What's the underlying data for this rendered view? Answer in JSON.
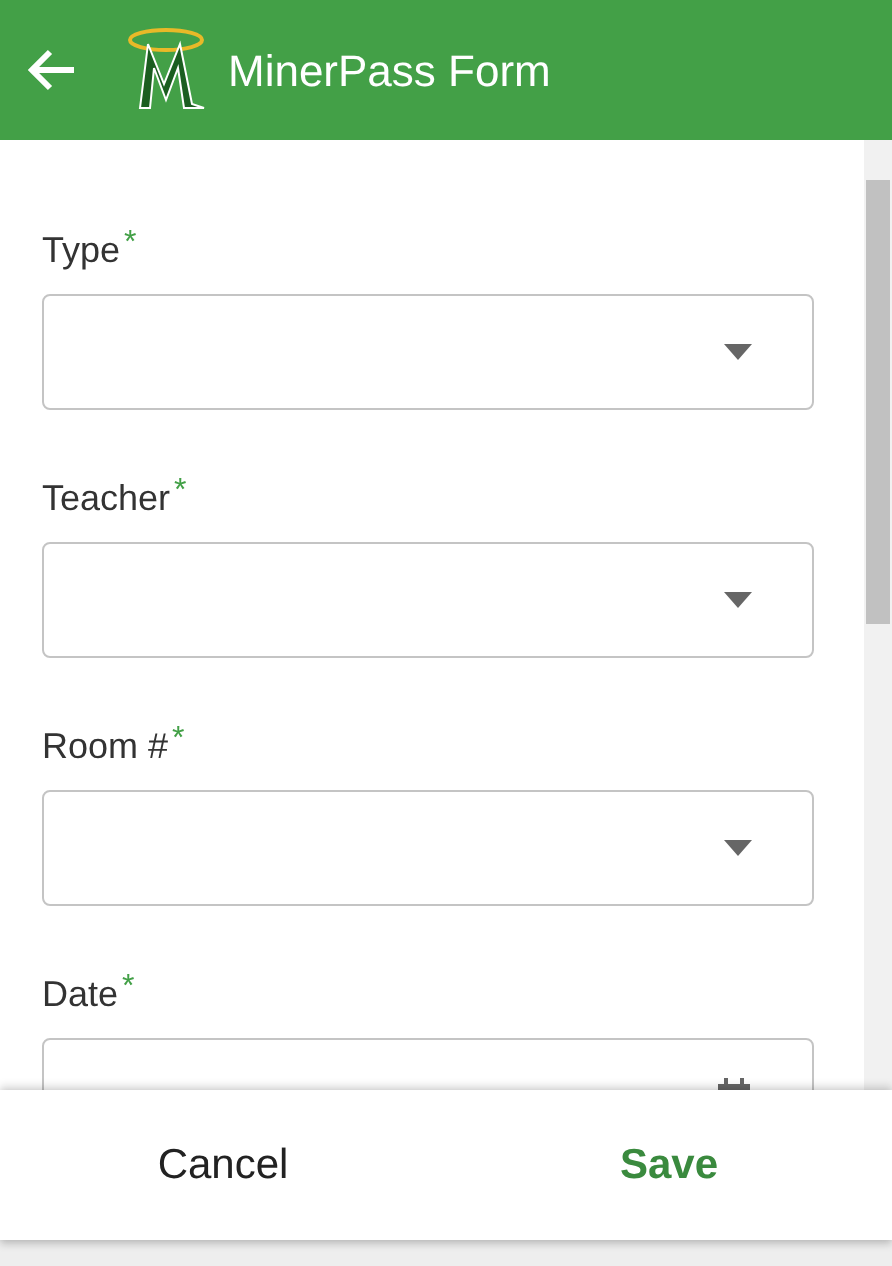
{
  "header": {
    "title": "MinerPass Form"
  },
  "fields": [
    {
      "label": "Type",
      "required_mark": "*",
      "kind": "dropdown"
    },
    {
      "label": "Teacher",
      "required_mark": "*",
      "kind": "dropdown"
    },
    {
      "label": "Room #",
      "required_mark": "*",
      "kind": "dropdown"
    },
    {
      "label": "Date",
      "required_mark": "*",
      "kind": "date"
    }
  ],
  "footer": {
    "cancel": "Cancel",
    "save": "Save"
  }
}
